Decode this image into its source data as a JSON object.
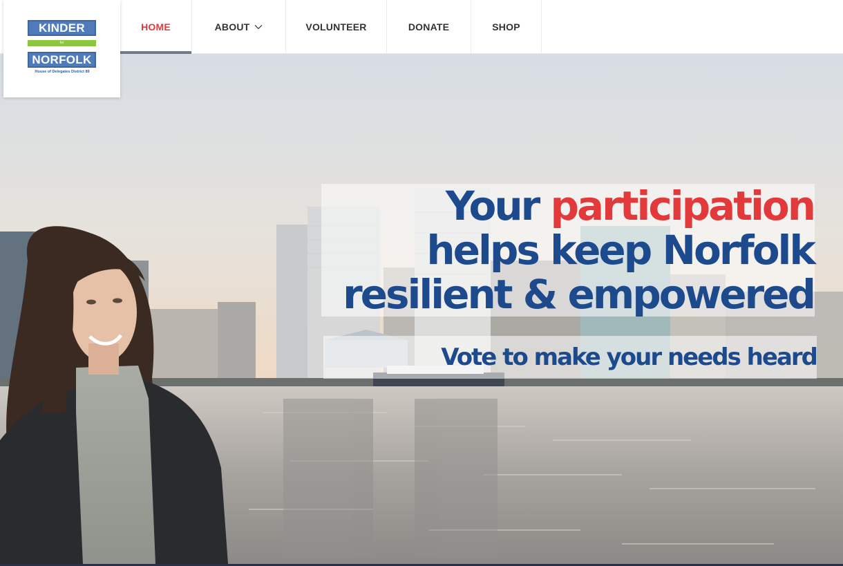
{
  "logo": {
    "top": "KINDER",
    "middle": "for",
    "bottom": "NORFOLK",
    "subtitle": "House of Delegates District 89"
  },
  "nav": {
    "items": [
      {
        "label": "HOME",
        "active": true
      },
      {
        "label": "ABOUT",
        "has_dropdown": true,
        "icon": "chevron-down-icon"
      },
      {
        "label": "VOLUNTEER"
      },
      {
        "label": "DONATE"
      },
      {
        "label": "SHOP"
      }
    ]
  },
  "hero": {
    "headline": {
      "line1_a": "Your",
      "line1_b": "participation",
      "line2": "helps keep Norfolk",
      "line3": "resilient & empowered"
    },
    "subheadline": "Vote to make your needs heard"
  },
  "colors": {
    "brand_blue": "#1d4a8d",
    "accent_red": "#e23a3a",
    "logo_blue": "#4f7bb8",
    "logo_green": "#8dc63f"
  }
}
